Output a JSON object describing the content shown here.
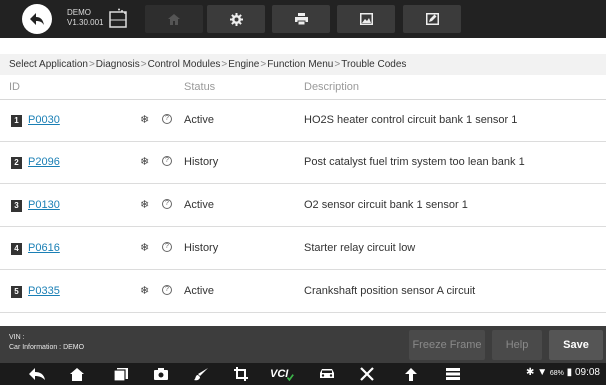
{
  "toolbar": {
    "demo_title": "DEMO",
    "version": "V1.30.001"
  },
  "breadcrumb": [
    "Select Application",
    "Diagnosis",
    "Control Modules",
    "Engine",
    "Function Menu",
    "Trouble Codes"
  ],
  "breadcrumb_separator": ">",
  "table": {
    "columns": {
      "id": "ID",
      "status": "Status",
      "description": "Description"
    },
    "rows": [
      {
        "num": "1",
        "code": "P0030",
        "status": "Active",
        "description": "HO2S heater control circuit bank 1  sensor 1"
      },
      {
        "num": "2",
        "code": "P2096",
        "status": "History",
        "description": "Post catalyst fuel trim system too lean bank 1"
      },
      {
        "num": "3",
        "code": "P0130",
        "status": "Active",
        "description": "O2 sensor circuit bank 1 sensor 1"
      },
      {
        "num": "4",
        "code": "P0616",
        "status": "History",
        "description": "Starter relay circuit low"
      },
      {
        "num": "5",
        "code": "P0335",
        "status": "Active",
        "description": "Crankshaft position sensor A circuit"
      }
    ]
  },
  "row_glyphs": {
    "freeze": "❄",
    "help": "?"
  },
  "footer": {
    "vin_label": "VIN :",
    "car_info": "Car Information : DEMO",
    "freeze_frame": "Freeze Frame",
    "help": "Help",
    "save": "Save"
  },
  "navbar": {
    "vci_label": "VCI",
    "battery": "68%",
    "time": "09:08"
  },
  "colors": {
    "toolbar_bg": "#222222",
    "link": "#1a7fb5",
    "footer_bg": "#3d3d3d",
    "navbar_bg": "#1b1b1b",
    "vci_check": "#3cb44a"
  },
  "icons": [
    "back-icon",
    "demo-icon",
    "home-icon",
    "settings-icon",
    "print-icon",
    "image-icon",
    "edit-icon",
    "nav-back-icon",
    "nav-home-icon",
    "nav-recents-icon",
    "camera-icon",
    "brush-icon",
    "crop-icon",
    "vci-icon",
    "car-icon",
    "tools-icon",
    "upload-icon",
    "menu-icon",
    "bluetooth-icon",
    "wifi-icon",
    "battery-icon"
  ]
}
